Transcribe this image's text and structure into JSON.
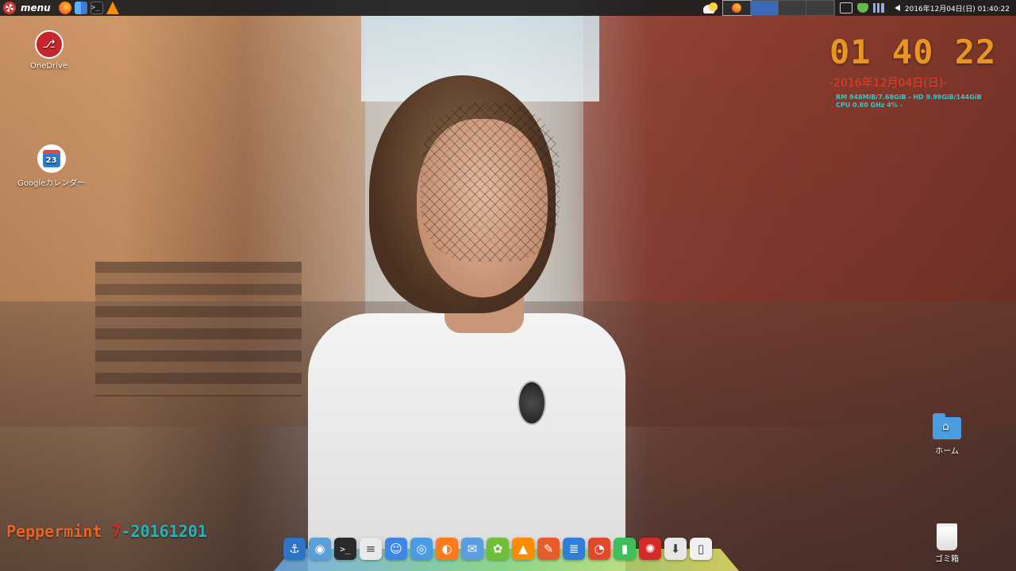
{
  "top_panel": {
    "menu_label": "menu",
    "launchers": [
      "firefox-icon",
      "finder-icon",
      "terminal-icon",
      "vlc-icon"
    ],
    "tasks": [
      "firefox-task",
      "blank-task",
      "blank-task-2"
    ],
    "clock": "2016年12月04日(日) 01:40:22"
  },
  "desktop": {
    "icons": [
      {
        "label": "OneDrive",
        "icon": "usb-icon"
      },
      {
        "label": "Googleカレンダー",
        "icon": "calendar-icon",
        "day": "23"
      },
      {
        "label": "ホーム",
        "icon": "home-folder-icon"
      },
      {
        "label": "ゴミ箱",
        "icon": "trash-icon"
      }
    ]
  },
  "conky": {
    "time": "01 40 22",
    "date": "-2016年12月04日(日)-",
    "mem": "RM 948MiB/7.68GiB - HD 9.99GiB/144GiB",
    "cpu": "CPU 0.80 GHz 4% -"
  },
  "branding": {
    "name": "Peppermint ",
    "number": "7",
    "version": "-20161201"
  },
  "dock": {
    "items": [
      {
        "name": "anchor-icon",
        "glyph": "⚓",
        "color": "#2b74c9"
      },
      {
        "name": "camera-icon",
        "glyph": "◉",
        "color": "#5aa0d8"
      },
      {
        "name": "terminal-icon",
        "glyph": ">_",
        "color": "#2a2a2a"
      },
      {
        "name": "notes-icon",
        "glyph": "≡",
        "color": "#e9e9e9"
      },
      {
        "name": "finder-icon",
        "glyph": "☺",
        "color": "#3d86e6"
      },
      {
        "name": "chromium-icon",
        "glyph": "◎",
        "color": "#4a9be0"
      },
      {
        "name": "firefox-icon",
        "glyph": "◐",
        "color": "#ff7a1a"
      },
      {
        "name": "mail-icon",
        "glyph": "✉",
        "color": "#5b9ee0"
      },
      {
        "name": "settings-icon",
        "glyph": "✿",
        "color": "#6fbf3a"
      },
      {
        "name": "vlc-icon",
        "glyph": "▲",
        "color": "#ff8c00"
      },
      {
        "name": "gimp-icon",
        "glyph": "✎",
        "color": "#e85b2a"
      },
      {
        "name": "writer-icon",
        "glyph": "≣",
        "color": "#2f7ed8"
      },
      {
        "name": "impress-icon",
        "glyph": "◔",
        "color": "#e0492b"
      },
      {
        "name": "calc-icon",
        "glyph": "▮",
        "color": "#3fbf5a"
      },
      {
        "name": "peppermint-icon",
        "glyph": "✺",
        "color": "#d32a2a"
      },
      {
        "name": "download-icon",
        "glyph": "⬇",
        "color": "#e7e7e7"
      },
      {
        "name": "trash-icon",
        "glyph": "▯",
        "color": "#f0f0f0"
      }
    ]
  }
}
